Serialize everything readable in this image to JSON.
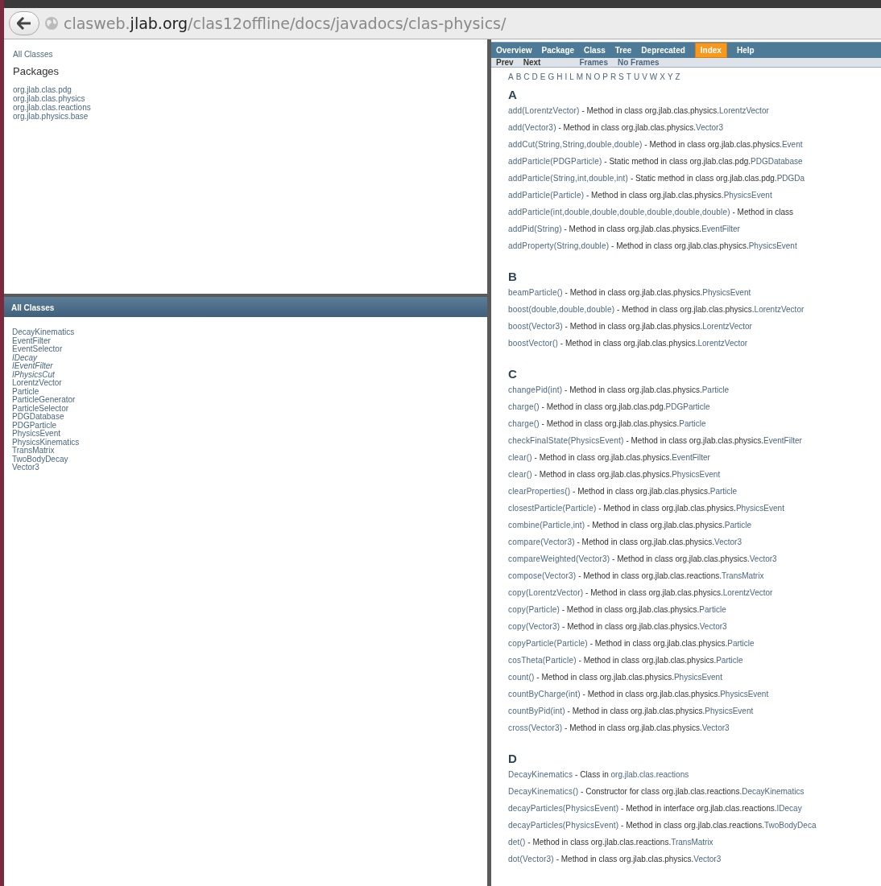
{
  "address_bar": {
    "url": "clasweb.**jlab.org**/clas12offline/docs/javadocs/clas-physics/"
  },
  "packages_frame": {
    "all_classes_link": "All Classes",
    "heading": "Packages",
    "packages": [
      "org.jlab.clas.pdg",
      "org.jlab.clas.physics",
      "org.jlab.clas.reactions",
      "org.jlab.physics.base"
    ]
  },
  "classes_frame": {
    "heading": "All Classes",
    "classes": [
      {
        "name": "DecayKinematics",
        "kind": "class"
      },
      {
        "name": "EventFilter",
        "kind": "class"
      },
      {
        "name": "EventSelector",
        "kind": "class"
      },
      {
        "name": "IDecay",
        "kind": "interface"
      },
      {
        "name": "IEventFilter",
        "kind": "interface"
      },
      {
        "name": "IPhysicsCut",
        "kind": "interface"
      },
      {
        "name": "LorentzVector",
        "kind": "class"
      },
      {
        "name": "Particle",
        "kind": "class"
      },
      {
        "name": "ParticleGenerator",
        "kind": "class"
      },
      {
        "name": "ParticleSelector",
        "kind": "class"
      },
      {
        "name": "PDGDatabase",
        "kind": "class"
      },
      {
        "name": "PDGParticle",
        "kind": "class"
      },
      {
        "name": "PhysicsEvent",
        "kind": "class"
      },
      {
        "name": "PhysicsKinematics",
        "kind": "class"
      },
      {
        "name": "TransMatrix",
        "kind": "class"
      },
      {
        "name": "TwoBodyDecay",
        "kind": "class"
      },
      {
        "name": "Vector3",
        "kind": "class"
      }
    ]
  },
  "nav_bar": {
    "items": [
      {
        "label": "Overview",
        "selected": false
      },
      {
        "label": "Package",
        "selected": false
      },
      {
        "label": "Class",
        "selected": false
      },
      {
        "label": "Tree",
        "selected": false
      },
      {
        "label": "Deprecated",
        "selected": false
      },
      {
        "label": "Index",
        "selected": true
      },
      {
        "label": "Help",
        "selected": false
      }
    ]
  },
  "sub_nav": {
    "items": [
      {
        "label": "Prev",
        "disabled": true
      },
      {
        "label": "Next",
        "disabled": true
      },
      {
        "label": "Frames",
        "disabled": false
      },
      {
        "label": "No Frames",
        "disabled": false
      }
    ]
  },
  "letters": [
    "A",
    "B",
    "C",
    "D",
    "E",
    "G",
    "H",
    "I",
    "L",
    "M",
    "N",
    "O",
    "P",
    "R",
    "S",
    "T",
    "U",
    "V",
    "W",
    "X",
    "Y",
    "Z"
  ],
  "sections": [
    {
      "letter": "A",
      "entries": [
        {
          "name": "add(LorentzVector)",
          "description": "- Method in class org.jlab.clas.physics.",
          "link": "LorentzVector"
        },
        {
          "name": "add(Vector3)",
          "description": "- Method in class org.jlab.clas.physics.",
          "link": "Vector3"
        },
        {
          "name": "addCut(String,String,double,double)",
          "description": "- Method in class org.jlab.clas.physics.",
          "link": "Event"
        },
        {
          "name": "addParticle(PDGParticle)",
          "description": "- Static method in class org.jlab.clas.pdg.",
          "link": "PDGDatabase"
        },
        {
          "name": "addParticle(String,int,double,int)",
          "description": "- Static method in class org.jlab.clas.pdg.",
          "link": "PDGDa"
        },
        {
          "name": "addParticle(Particle)",
          "description": "- Method in class org.jlab.clas.physics.",
          "link": "PhysicsEvent"
        },
        {
          "name": "addParticle(int,double,double,double,double,double,double)",
          "description": "- Method in class"
        },
        {
          "name": "addPid(String)",
          "description": "- Method in class org.jlab.clas.physics.",
          "link": "EventFilter"
        },
        {
          "name": "addProperty(String,double)",
          "description": "- Method in class org.jlab.clas.physics.",
          "link": "PhysicsEvent"
        }
      ]
    },
    {
      "letter": "B",
      "entries": [
        {
          "name": "beamParticle()",
          "description": "- Method in class org.jlab.clas.physics.",
          "link": "PhysicsEvent"
        },
        {
          "name": "boost(double,double,double)",
          "description": "- Method in class org.jlab.clas.physics.",
          "link": "LorentzVector"
        },
        {
          "name": "boost(Vector3)",
          "description": "- Method in class org.jlab.clas.physics.",
          "link": "LorentzVector"
        },
        {
          "name": "boostVector()",
          "description": "- Method in class org.jlab.clas.physics.",
          "link": "LorentzVector"
        }
      ]
    },
    {
      "letter": "C",
      "entries": [
        {
          "name": "changePid(int)",
          "description": "- Method in class org.jlab.clas.physics.",
          "link": "Particle"
        },
        {
          "name": "charge()",
          "description": "- Method in class org.jlab.clas.pdg.",
          "link": "PDGParticle"
        },
        {
          "name": "charge()",
          "description": "- Method in class org.jlab.clas.physics.",
          "link": "Particle"
        },
        {
          "name": "checkFinalState(PhysicsEvent)",
          "description": "- Method in class org.jlab.clas.physics.",
          "link": "EventFilter"
        },
        {
          "name": "clear()",
          "description": "- Method in class org.jlab.clas.physics.",
          "link": "EventFilter"
        },
        {
          "name": "clear()",
          "description": "- Method in class org.jlab.clas.physics.",
          "link": "PhysicsEvent"
        },
        {
          "name": "clearProperties()",
          "description": "- Method in class org.jlab.clas.physics.",
          "link": "Particle"
        },
        {
          "name": "closestParticle(Particle)",
          "description": "- Method in class org.jlab.clas.physics.",
          "link": "PhysicsEvent"
        },
        {
          "name": "combine(Particle,int)",
          "description": "- Method in class org.jlab.clas.physics.",
          "link": "Particle"
        },
        {
          "name": "compare(Vector3)",
          "description": "- Method in class org.jlab.clas.physics.",
          "link": "Vector3"
        },
        {
          "name": "compareWeighted(Vector3)",
          "description": "- Method in class org.jlab.clas.physics.",
          "link": "Vector3"
        },
        {
          "name": "compose(Vector3)",
          "description": "- Method in class org.jlab.clas.reactions.",
          "link": "TransMatrix"
        },
        {
          "name": "copy(LorentzVector)",
          "description": "- Method in class org.jlab.clas.physics.",
          "link": "LorentzVector"
        },
        {
          "name": "copy(Particle)",
          "description": "- Method in class org.jlab.clas.physics.",
          "link": "Particle"
        },
        {
          "name": "copy(Vector3)",
          "description": "- Method in class org.jlab.clas.physics.",
          "link": "Vector3"
        },
        {
          "name": "copyParticle(Particle)",
          "description": "- Method in class org.jlab.clas.physics.",
          "link": "Particle"
        },
        {
          "name": "cosTheta(Particle)",
          "description": "- Method in class org.jlab.clas.physics.",
          "link": "Particle"
        },
        {
          "name": "count()",
          "description": "- Method in class org.jlab.clas.physics.",
          "link": "PhysicsEvent"
        },
        {
          "name": "countByCharge(int)",
          "description": "- Method in class org.jlab.clas.physics.",
          "link": "PhysicsEvent"
        },
        {
          "name": "countByPid(int)",
          "description": "- Method in class org.jlab.clas.physics.",
          "link": "PhysicsEvent"
        },
        {
          "name": "cross(Vector3)",
          "description": "- Method in class org.jlab.clas.physics.",
          "link": "Vector3"
        }
      ]
    },
    {
      "letter": "D",
      "entries": [
        {
          "name": "DecayKinematics",
          "description": "- Class in ",
          "link": "org.jlab.clas.reactions"
        },
        {
          "name": "DecayKinematics()",
          "description": "- Constructor for class org.jlab.clas.reactions.",
          "link": "DecayKinematics"
        },
        {
          "name": "decayParticles(PhysicsEvent)",
          "description": "- Method in interface org.jlab.clas.reactions.",
          "link": "IDecay"
        },
        {
          "name": "decayParticles(PhysicsEvent)",
          "description": "- Method in class org.jlab.clas.reactions.",
          "link": "TwoBodyDeca"
        },
        {
          "name": "det()",
          "description": "- Method in class org.jlab.clas.reactions.",
          "link": "TransMatrix"
        },
        {
          "name": "dot(Vector3)",
          "description": "- Method in class org.jlab.clas.physics.",
          "link": "Vector3"
        }
      ]
    }
  ]
}
